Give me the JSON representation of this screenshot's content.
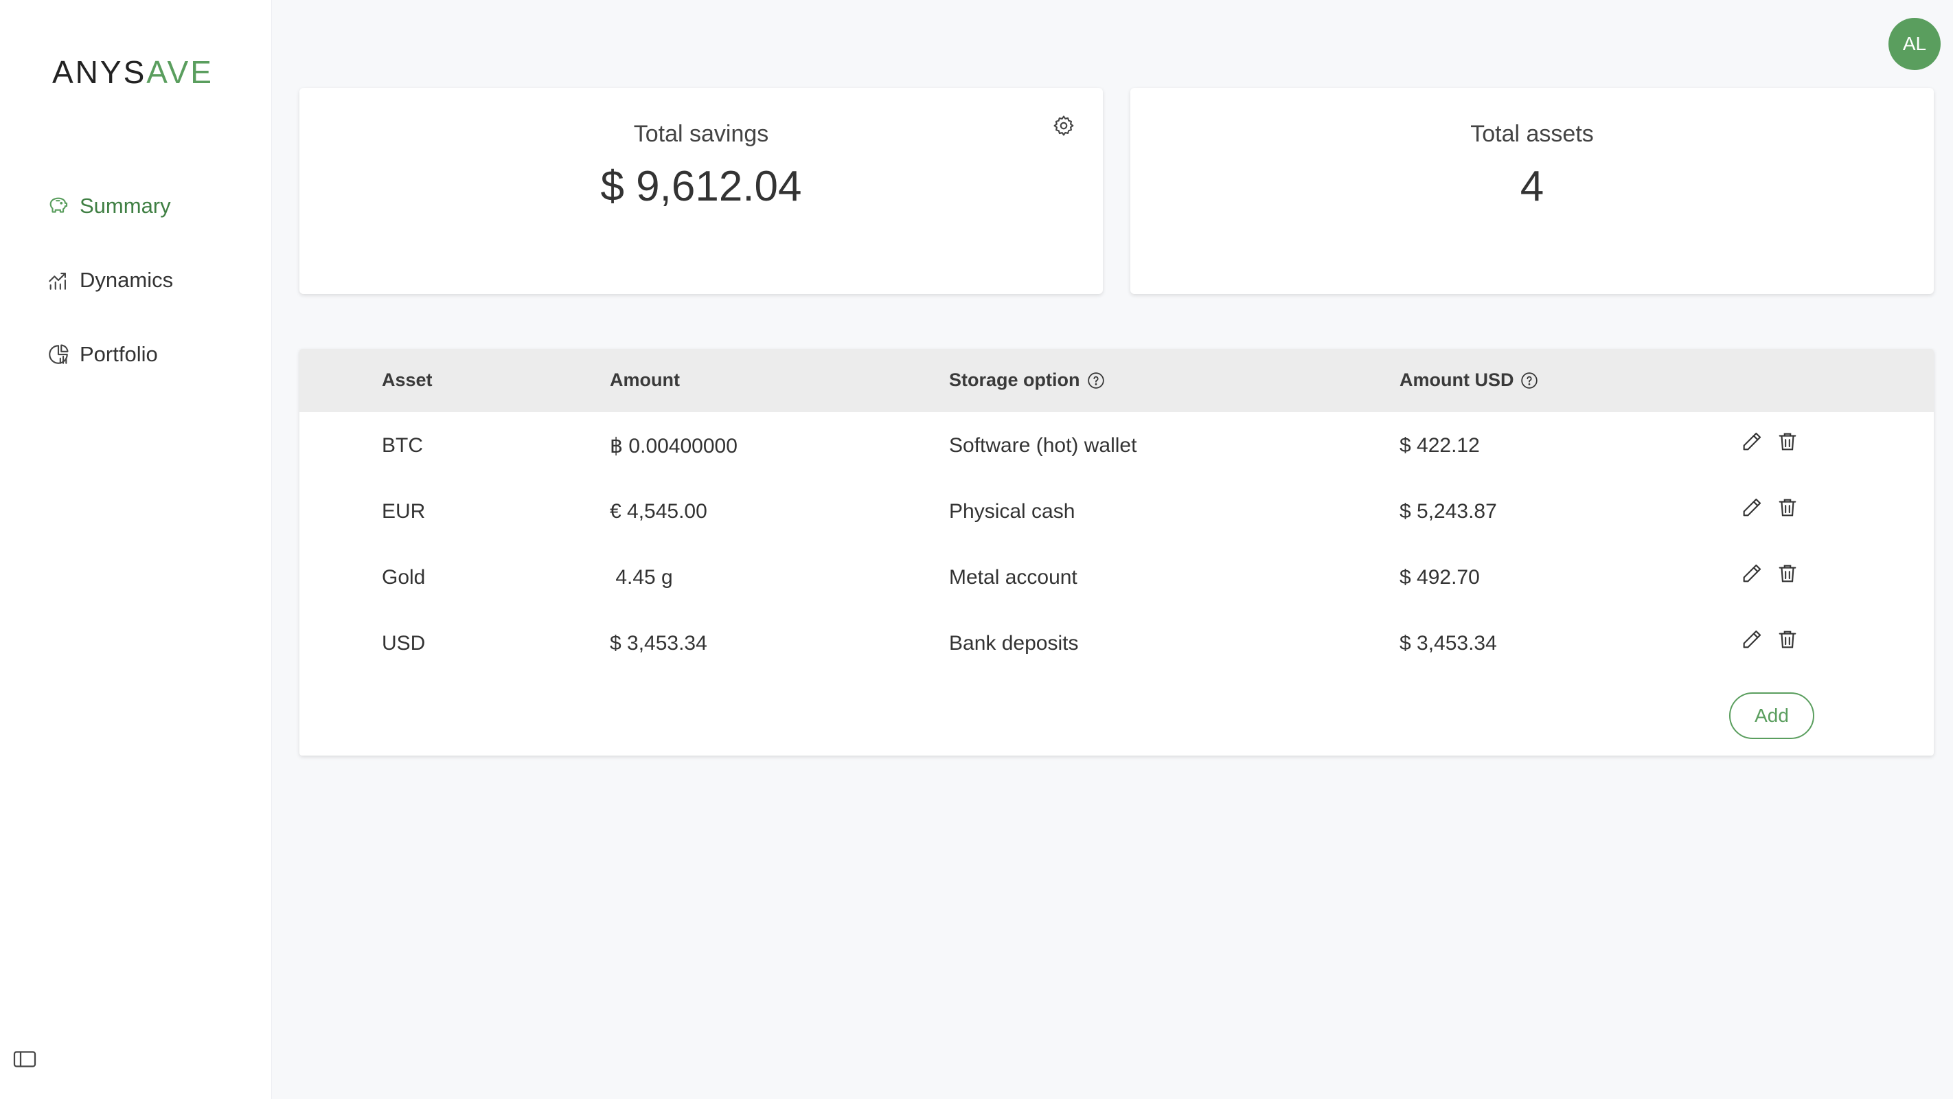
{
  "app": {
    "logo_main": "ANYS",
    "logo_accent": "AVE",
    "user_initials": "AL"
  },
  "sidebar": {
    "items": [
      {
        "label": "Summary",
        "icon": "piggy-bank-icon",
        "active": true
      },
      {
        "label": "Dynamics",
        "icon": "chart-growth-icon",
        "active": false
      },
      {
        "label": "Portfolio",
        "icon": "pie-chart-icon",
        "active": false
      }
    ]
  },
  "cards": {
    "savings": {
      "title": "Total savings",
      "value": "$ 9,612.04"
    },
    "assets": {
      "title": "Total assets",
      "value": "4"
    }
  },
  "table": {
    "headers": [
      "Asset",
      "Amount",
      "Storage option",
      "Amount USD"
    ],
    "rows": [
      {
        "asset": "BTC",
        "amount": "฿ 0.00400000",
        "storage": "Software (hot) wallet",
        "usd": "$ 422.12"
      },
      {
        "asset": "EUR",
        "amount": "€ 4,545.00",
        "storage": "Physical cash",
        "usd": "$ 5,243.87"
      },
      {
        "asset": "Gold",
        "amount": " 4.45 g",
        "storage": "Metal account",
        "usd": "$ 492.70"
      },
      {
        "asset": "USD",
        "amount": "$ 3,453.34",
        "storage": "Bank deposits",
        "usd": "$ 3,453.34"
      }
    ],
    "add_label": "Add"
  },
  "colors": {
    "accent": "#5a9e5e",
    "active_nav": "#3f7f43",
    "header_bg": "#ececec",
    "page_bg": "#f7f8fa"
  }
}
